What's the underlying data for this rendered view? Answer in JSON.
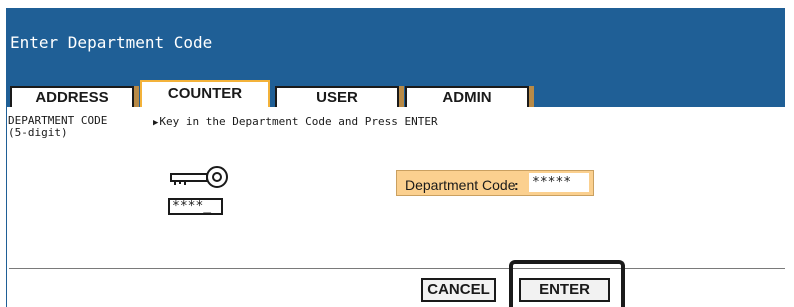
{
  "window": {
    "title": "Enter Department Code"
  },
  "tabs": [
    {
      "label": "ADDRESS",
      "active": false
    },
    {
      "label": "COUNTER",
      "active": true
    },
    {
      "label": "USER",
      "active": false
    },
    {
      "label": "ADMIN",
      "active": false
    }
  ],
  "main": {
    "dept_label_line1": "DEPARTMENT CODE",
    "dept_label_line2": "(5-digit)",
    "instruction_arrow": "▶",
    "instruction": "Key in the Department Code and Press ENTER",
    "key_icon": "key-icon",
    "code_display": "****_",
    "field": {
      "label": "Department Code",
      "colon": ":",
      "value": "*****"
    }
  },
  "buttons": {
    "cancel": "CANCEL",
    "enter": "ENTER"
  },
  "colors": {
    "title_bar": "#1f5f96",
    "active_tab_border": "#f3b23a",
    "field_background": "#fbd08f"
  }
}
